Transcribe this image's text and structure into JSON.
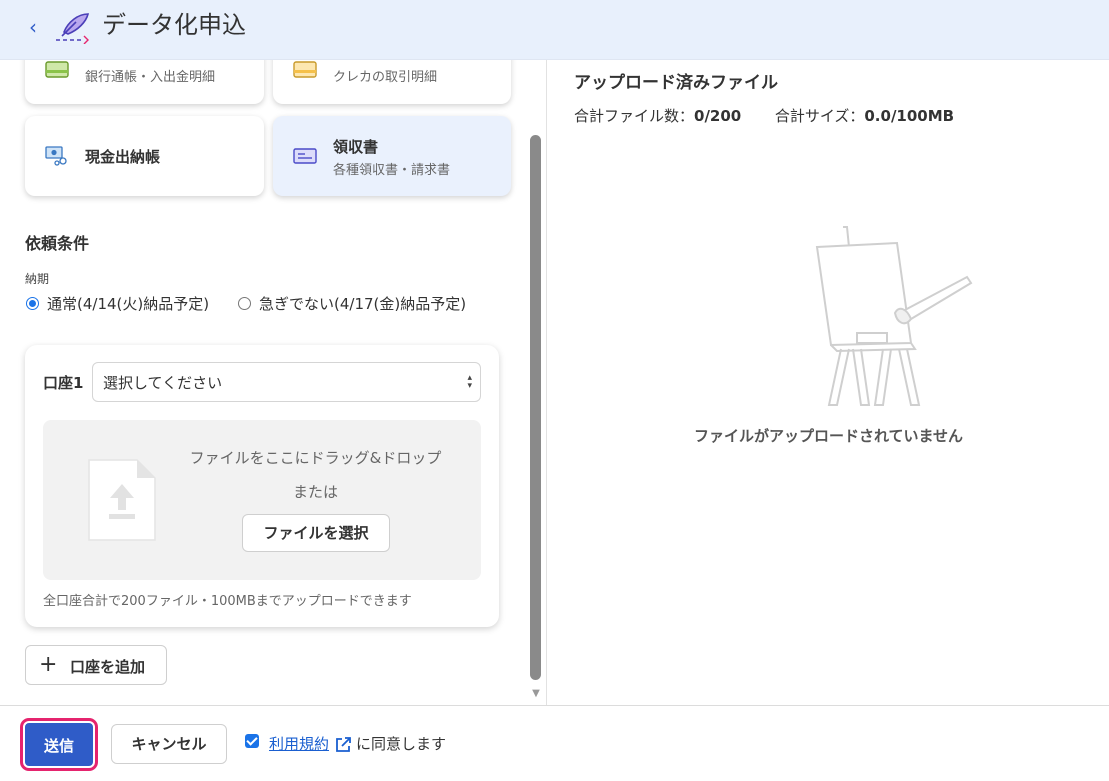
{
  "header": {
    "back_icon": "chevron-left-icon",
    "logo_icon": "quill-pen-icon",
    "title": "データ化申込"
  },
  "document_types": [
    {
      "title": "",
      "subtitle": "銀行通帳・入出金明細",
      "icon": "bankbook-icon",
      "color": "#8bc34a"
    },
    {
      "title": "",
      "subtitle": "クレカの取引明細",
      "icon": "credit-card-icon",
      "color": "#f5c04a"
    },
    {
      "title": "現金出納帳",
      "subtitle": "",
      "icon": "cash-icon",
      "color": "#4a8fd8"
    },
    {
      "title": "領収書",
      "subtitle": "各種領収書・請求書",
      "icon": "receipt-icon",
      "color": "#5b5bd6",
      "selected": true
    }
  ],
  "conditions": {
    "title": "依頼条件",
    "deadline_label": "納期",
    "options": [
      {
        "label": "通常(4/14(火)納品予定)",
        "checked": true
      },
      {
        "label": "急ぎでない(4/17(金)納品予定)",
        "checked": false
      }
    ]
  },
  "account": {
    "label": "口座1",
    "select_value": "選択してください",
    "drop_text": "ファイルをここにドラッグ&ドロップ",
    "or_text": "または",
    "choose_file_label": "ファイルを選択",
    "limit_text": "全口座合計で200ファイル・100MBまでアップロードできます"
  },
  "add_account_label": "口座を追加",
  "uploaded": {
    "title": "アップロード済みファイル",
    "file_count_label": "合計ファイル数：",
    "file_count_value": "0/200",
    "size_label": "合計サイズ：",
    "size_value": "0.0/100MB",
    "empty_text": "ファイルがアップロードされていません"
  },
  "footer": {
    "submit_label": "送信",
    "cancel_label": "キャンセル",
    "terms_link": "利用規約",
    "agree_suffix": "に同意します",
    "agree_checked": true
  },
  "colors": {
    "accent": "#2f5cc8",
    "header_bg": "#e8f0fc",
    "focus_outline": "#e5246e",
    "link": "#1a5fd0"
  }
}
